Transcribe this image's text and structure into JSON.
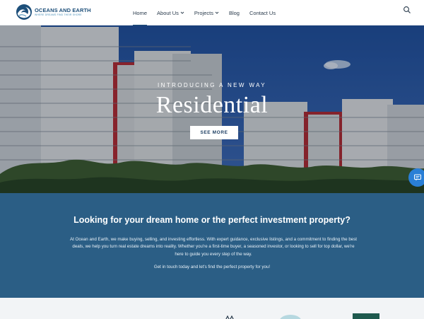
{
  "site": {
    "logo_name": "OCEANS AND EARTH",
    "logo_tagline": "WHERE DREAMS FIND THEIR SHORE",
    "brand_color": "#1d4f7a",
    "accent_color": "#2b5e85"
  },
  "nav": {
    "items": [
      {
        "label": "Home",
        "active": true
      },
      {
        "label": "About Us",
        "dropdown": true
      },
      {
        "label": "Projects",
        "dropdown": true
      },
      {
        "label": "Blog"
      },
      {
        "label": "Contact Us"
      }
    ],
    "search_icon": "search-icon"
  },
  "hero": {
    "kicker": "INTRODUCING A NEW WAY",
    "title": "Residential",
    "button": "SEE MORE",
    "chat_icon": "chat-icon"
  },
  "info": {
    "heading": "Looking for your dream home or the perfect investment property?",
    "body": "At Ocean and Earth, we make buying, selling, and investing effortless. With expert guidance, exclusive listings, and a commitment to finding the best deals, we help you turn real estate dreams into reality. Whether you're a first-time buyer, a seasoned investor, or looking to sell for top dollar, we're here to guide you every step of the way.",
    "cta": "Get in touch today and let's find the perfect property for you!"
  }
}
